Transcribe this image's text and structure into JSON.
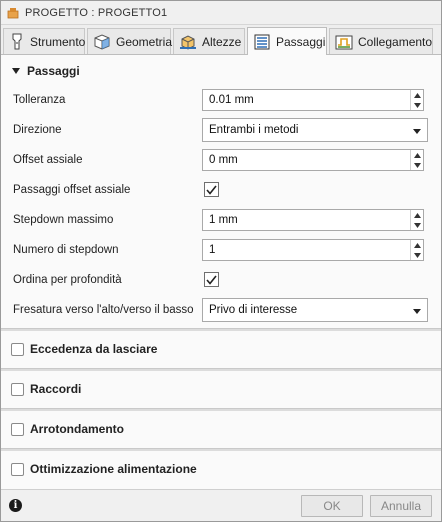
{
  "window": {
    "title": "PROGETTO : PROGETTO1"
  },
  "tabs": [
    {
      "label": "Strumento",
      "icon": "tool-icon",
      "active": false
    },
    {
      "label": "Geometria",
      "icon": "geometry-icon",
      "active": false
    },
    {
      "label": "Altezze",
      "icon": "heights-icon",
      "active": false
    },
    {
      "label": "Passaggi",
      "icon": "passes-icon",
      "active": true
    },
    {
      "label": "Collegamento",
      "icon": "linking-icon",
      "active": false
    }
  ],
  "passes_section": {
    "title": "Passaggi",
    "expanded": true,
    "tolerance": {
      "label": "Tolleranza",
      "value": "0.01 mm"
    },
    "direction": {
      "label": "Direzione",
      "value": "Entrambi i metodi"
    },
    "axial_offset": {
      "label": "Offset assiale",
      "value": "0 mm"
    },
    "axial_offset_passes": {
      "label": "Passaggi offset assiale",
      "checked": true
    },
    "max_stepdown": {
      "label": "Stepdown massimo",
      "value": "1 mm"
    },
    "stepdown_count": {
      "label": "Numero di stepdown",
      "value": "1"
    },
    "order_by_depth": {
      "label": "Ordina per profondità",
      "checked": true
    },
    "milling_direction": {
      "label": "Fresatura verso l'alto/verso il basso",
      "value": "Privo di interesse"
    }
  },
  "sections": [
    {
      "title": "Eccedenza da lasciare",
      "checked": false
    },
    {
      "title": "Raccordi",
      "checked": false
    },
    {
      "title": "Arrotondamento",
      "checked": false
    },
    {
      "title": "Ottimizzazione alimentazione",
      "checked": false
    }
  ],
  "footer": {
    "ok_label": "OK",
    "cancel_label": "Annulla",
    "info_glyph": "i"
  },
  "colors": {
    "active_tab_bg": "#fafafa",
    "inactive_tab_bg": "#e9e9e9",
    "icon_blue": "#2f6fb5",
    "icon_orange": "#f0a030",
    "icon_green": "#5a9a3a"
  }
}
